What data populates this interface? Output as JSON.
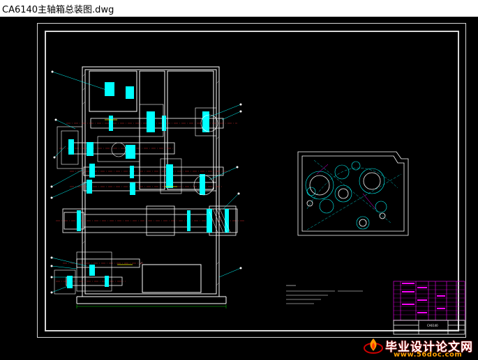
{
  "window": {
    "title": "CA6140主轴箱总装图.dwg"
  },
  "colors": {
    "background": "#000000",
    "line_white": "#ffffff",
    "cyan": "#00ffff",
    "magenta": "#ff00ff",
    "green": "#00ff00",
    "yellow": "#ffff00"
  },
  "title_block": {
    "drawing_name": "CA6140"
  },
  "watermark": {
    "text": "毕业设计论文网",
    "url": "www.56doc.com",
    "logo": "flame-logo-icon"
  }
}
